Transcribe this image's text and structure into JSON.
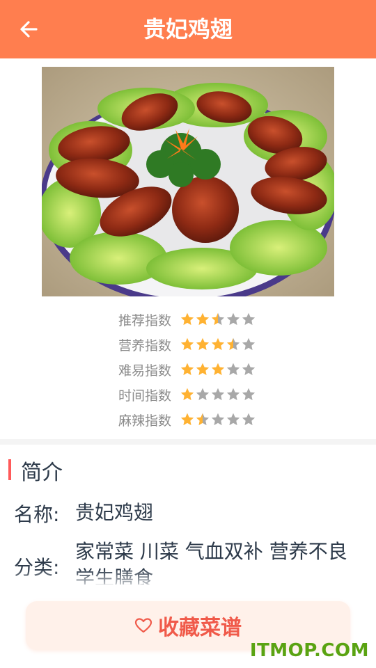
{
  "header": {
    "title": "贵妃鸡翅",
    "back_icon": "arrow-left-icon"
  },
  "dish_image": {
    "alt": "贵妃鸡翅"
  },
  "ratings": [
    {
      "label": "推荐指数",
      "score": 2.5,
      "max": 5
    },
    {
      "label": "营养指数",
      "score": 3.5,
      "max": 5
    },
    {
      "label": "难易指数",
      "score": 3,
      "max": 5
    },
    {
      "label": "时间指数",
      "score": 1,
      "max": 5
    },
    {
      "label": "麻辣指数",
      "score": 1.5,
      "max": 5
    }
  ],
  "intro": {
    "title": "简介",
    "name_label": "名称:",
    "name_value": "贵妃鸡翅",
    "category_label": "分类:",
    "category_value": "家常菜 川菜 气血双补 营养不良 学生膳食"
  },
  "favorite_button": {
    "label": "收藏菜谱",
    "icon": "heart-outline-icon"
  },
  "watermark": "ITMOP.COM",
  "colors": {
    "header": "#ff7e4f",
    "star_filled": "#ffb232",
    "star_empty": "#a8a8a8",
    "accent": "#f05a4a",
    "intro_bar": "#ff5a5a"
  }
}
